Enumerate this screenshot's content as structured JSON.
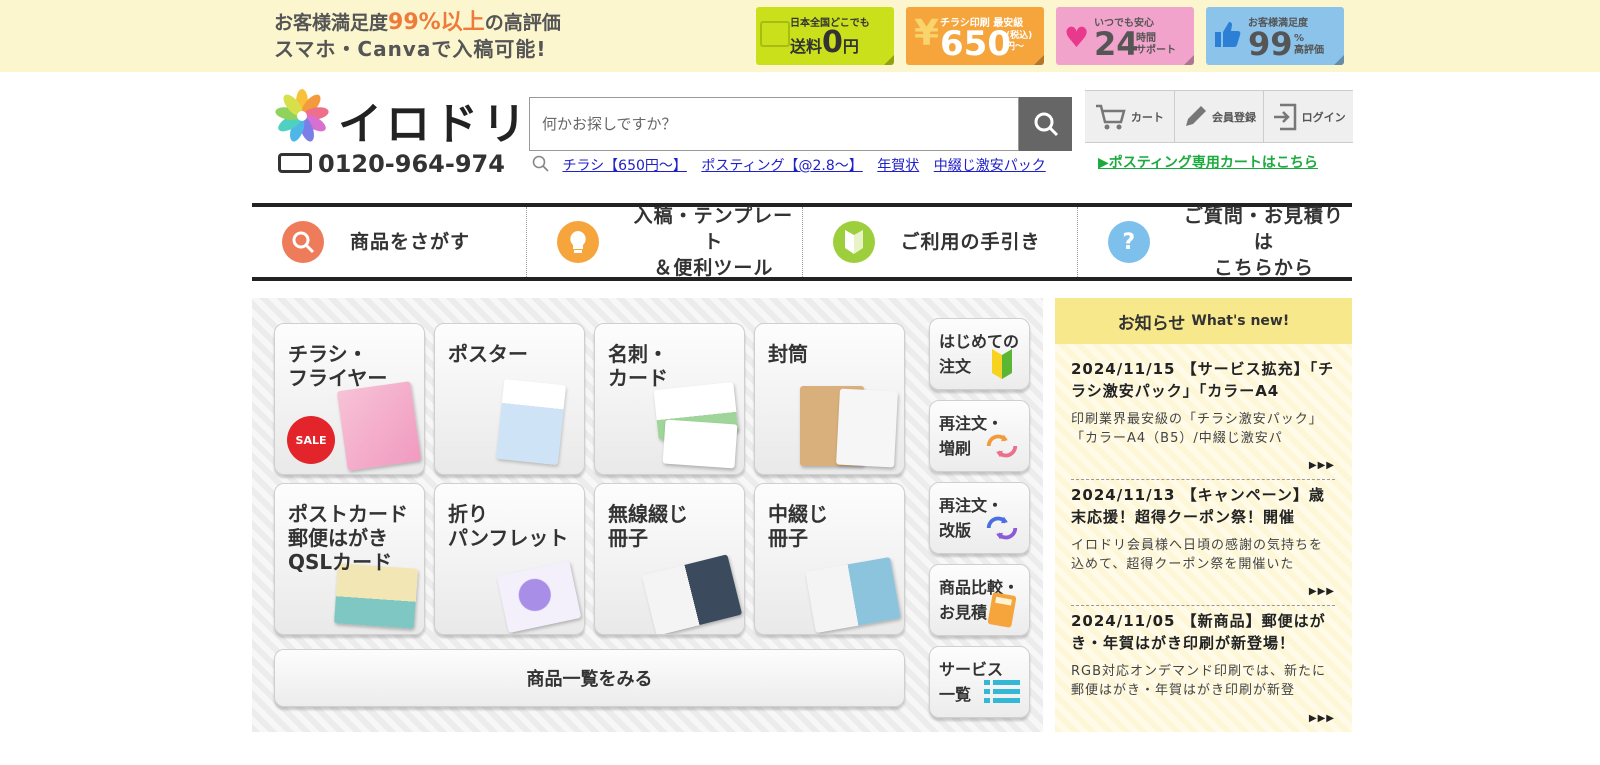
{
  "banner": {
    "tagline_1_pre": "お客様満足度",
    "tagline_1_hl": "99%以上",
    "tagline_1_post": "の高評価",
    "tagline_2": "スマホ・Canvaで入稿可能!",
    "badges": [
      {
        "small": "日本全国どこでも",
        "big_pre": "送料",
        "big": "0",
        "big_post": "円"
      },
      {
        "small": "チラシ印刷 最安級",
        "big": "650",
        "sub1": "(税込)",
        "sub2": "円〜",
        "yen": "¥"
      },
      {
        "small": "いつでも安心",
        "big": "24",
        "sub1": "時間",
        "sub2": "サポート"
      },
      {
        "small": "お客様満足度",
        "big": "99",
        "sub1": "%",
        "sub2": "高評価"
      }
    ]
  },
  "header": {
    "logo_text": "イロドリ",
    "phone": "0120-964-974",
    "search_placeholder": "何かお探しですか？",
    "quick_links": [
      "チラシ【650円〜】",
      "ポスティング【@2.8〜】",
      "年賀状",
      "中綴じ激安パック"
    ],
    "actions": [
      "カート",
      "会員登録",
      "ログイン"
    ],
    "posting_link": "▶ポスティング専用カートはこちら"
  },
  "nav": [
    {
      "label_1": "商品をさがす",
      "label_2": "",
      "color": "#ee7b5a"
    },
    {
      "label_1": "入稿・テンプレート",
      "label_2": "＆便利ツール",
      "color": "#f5a53c"
    },
    {
      "label_1": "ご利用の手引き",
      "label_2": "",
      "color": "#9ccf3b"
    },
    {
      "label_1": "ご質問・お見積りは",
      "label_2": "こちらから",
      "color": "#7ec0ec"
    }
  ],
  "products": [
    {
      "line1": "チラシ・",
      "line2": "フライヤー",
      "line3": ""
    },
    {
      "line1": "ポスター",
      "line2": "",
      "line3": ""
    },
    {
      "line1": "名刺・",
      "line2": "カード",
      "line3": ""
    },
    {
      "line1": "封筒",
      "line2": "",
      "line3": ""
    },
    {
      "line1": "ポストカード",
      "line2": "郵便はがき",
      "line3": "QSLカード"
    },
    {
      "line1": "折り",
      "line2": "パンフレット",
      "line3": ""
    },
    {
      "line1": "無線綴じ",
      "line2": "冊子",
      "line3": ""
    },
    {
      "line1": "中綴じ",
      "line2": "冊子",
      "line3": ""
    }
  ],
  "sale_label": "SALE",
  "all_products": "商品一覧をみる",
  "side_buttons": [
    {
      "line1": "はじめての",
      "line2": "注文"
    },
    {
      "line1": "再注文・",
      "line2": "増刷"
    },
    {
      "line1": "再注文・",
      "line2": "改版"
    },
    {
      "line1": "商品比較・",
      "line2": "お見積"
    },
    {
      "line1": "サービス",
      "line2": "一覧"
    }
  ],
  "news": {
    "heading": "お知らせ",
    "heading_en": "What's new!",
    "more": "▶▶▶",
    "items": [
      {
        "title": "2024/11/15 【サービス拡充】「チラシ激安パック」「カラーA4",
        "body": "印刷業界最安級の「チラシ激安パック」「カラーA4（B5）/中綴じ激安パ"
      },
      {
        "title": "2024/11/13 【キャンペーン】歳末応援！超得クーポン祭！開催",
        "body": "イロドリ会員様へ日頃の感謝の気持ちを込めて、超得クーポン祭を開催いた"
      },
      {
        "title": "2024/11/05 【新商品】郵便はがき・年賀はがき印刷が新登場！",
        "body": "RGB対応オンデマンド印刷では、新たに郵便はがき・年賀はがき印刷が新登"
      }
    ]
  },
  "colors": {
    "banner_bg": "#fcf6cf",
    "accent_orange": "#ee7b3a",
    "news_head": "#f7e98b",
    "posting_green": "#1aaa3e",
    "link_blue": "#2020c8"
  }
}
